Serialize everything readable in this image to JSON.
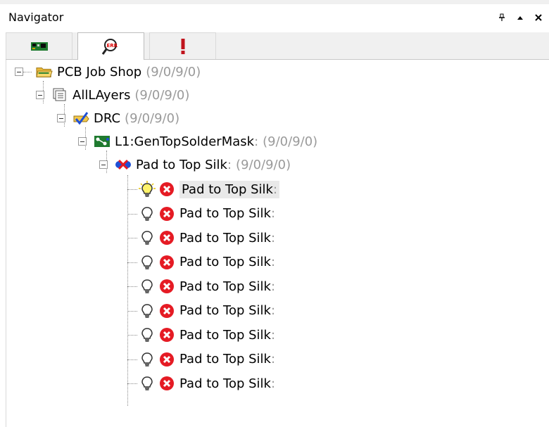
{
  "panel": {
    "title": "Navigator"
  },
  "window_buttons": {
    "pin_icon": "pin-icon",
    "collapse_icon": "caret-up-icon",
    "close_icon": "close-icon"
  },
  "tabs": [
    {
      "name": "board-tab",
      "icon": "pcb-board-icon",
      "active": false
    },
    {
      "name": "drc-tab",
      "icon": "magnifier-error-icon",
      "active": true
    },
    {
      "name": "errors-tab",
      "icon": "exclamation-icon",
      "active": false
    }
  ],
  "tree": {
    "root": {
      "label": "PCB Job Shop",
      "count": "(9/0/9/0)",
      "icon": "folder-icon"
    },
    "layers": {
      "label": "AllLAyers",
      "count": "(9/0/9/0)",
      "icon": "layers-icon"
    },
    "drc": {
      "label": "DRC",
      "count": "(9/0/9/0)",
      "icon": "drc-check-icon"
    },
    "layer": {
      "label": "L1:GenTopSolderMask",
      "colon": ":",
      "count": "(9/0/9/0)",
      "icon": "layer-net-icon"
    },
    "rule": {
      "label": "Pad to Top Silk",
      "colon": ":",
      "count": "(9/0/9/0)",
      "icon": "rule-icon"
    },
    "violations": [
      {
        "label": "Pad to Top Silk",
        "colon": ":",
        "selected": true
      },
      {
        "label": "Pad to Top Silk",
        "colon": ":"
      },
      {
        "label": "Pad to Top Silk",
        "colon": ":"
      },
      {
        "label": "Pad to Top Silk",
        "colon": ":"
      },
      {
        "label": "Pad to Top Silk",
        "colon": ":"
      },
      {
        "label": "Pad to Top Silk",
        "colon": ":"
      },
      {
        "label": "Pad to Top Silk",
        "colon": ":"
      },
      {
        "label": "Pad to Top Silk",
        "colon": ":"
      },
      {
        "label": "Pad to Top Silk",
        "colon": ":"
      }
    ]
  },
  "colors": {
    "error": "#e51b24",
    "selection": "#e9e9e9",
    "count_text": "#9a9a9a"
  }
}
